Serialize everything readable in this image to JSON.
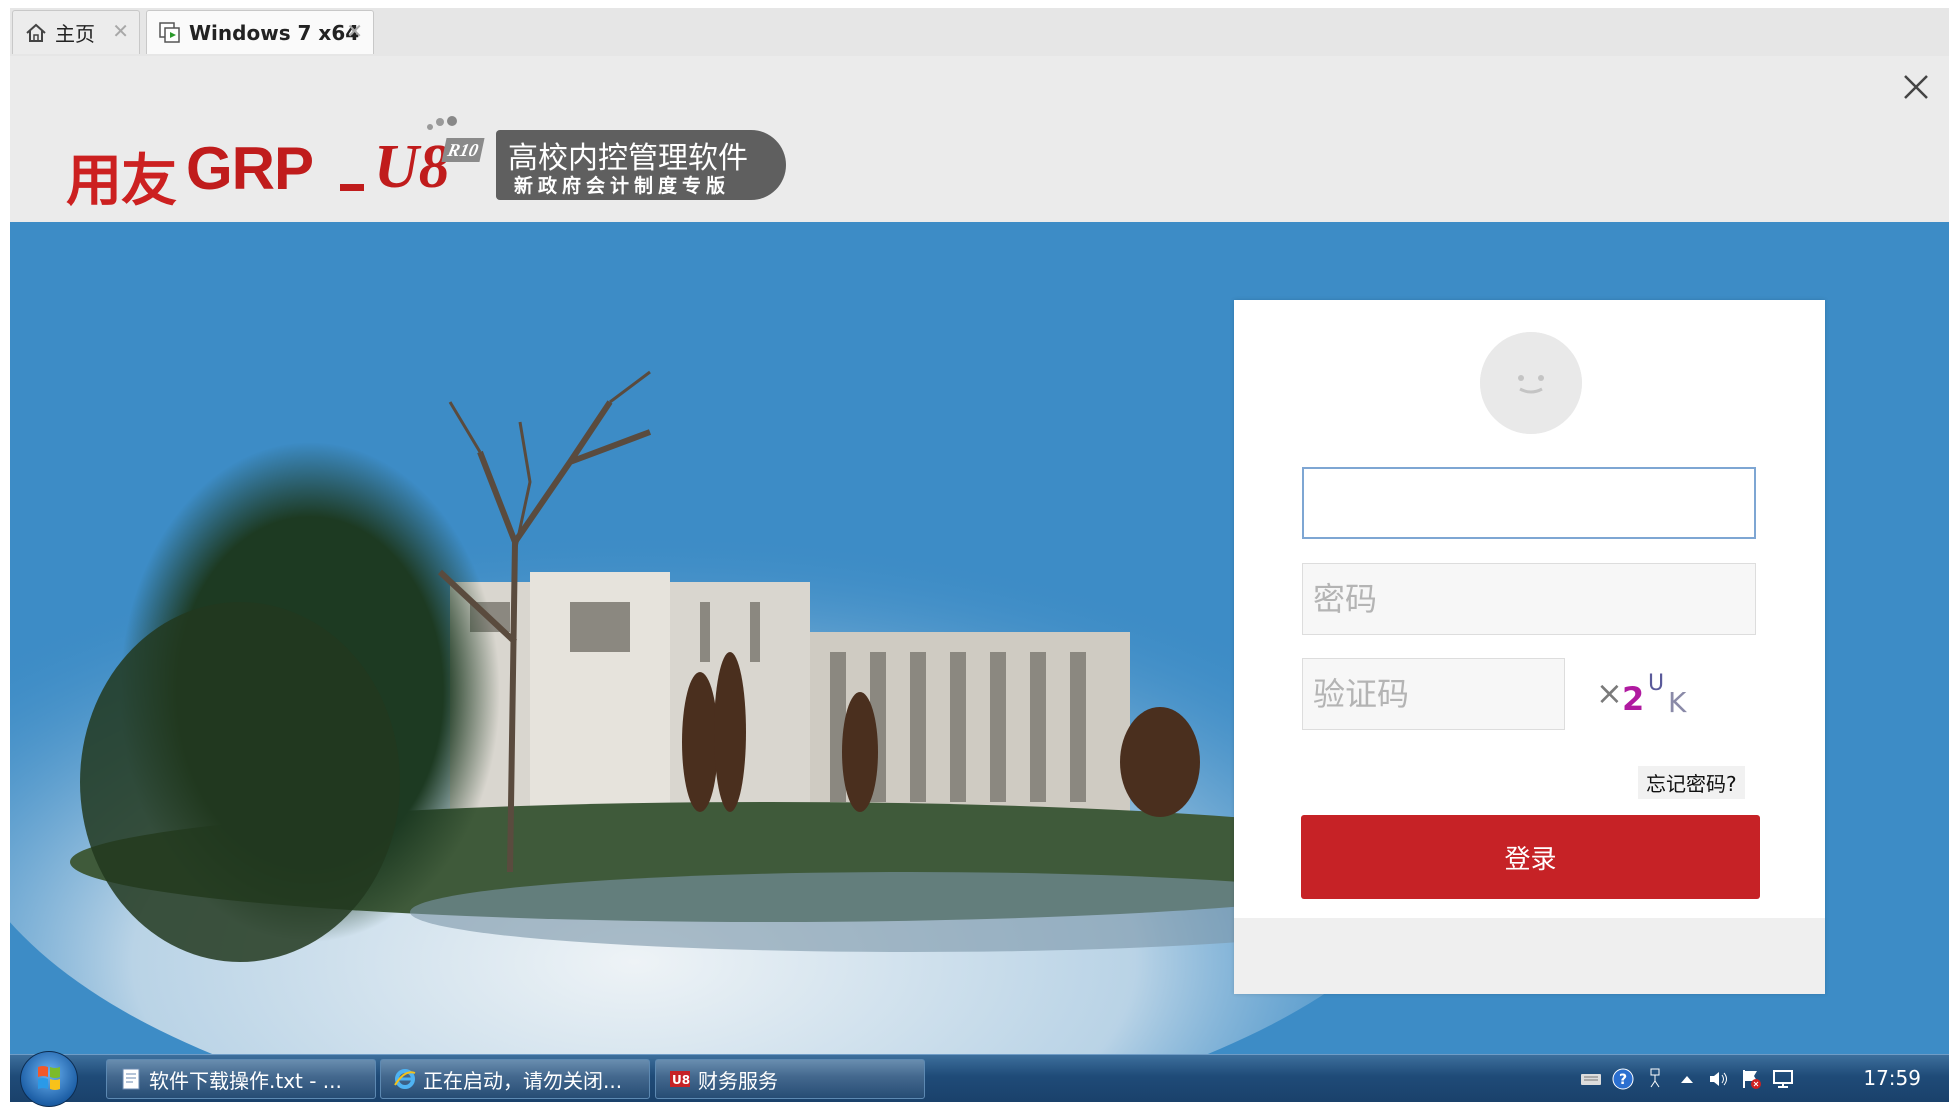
{
  "tabs": [
    {
      "label": "主页",
      "icon": "home-icon"
    },
    {
      "label": "Windows 7 x64",
      "icon": "vm-icon"
    }
  ],
  "header": {
    "logo_brand": "用友",
    "logo_product": "GRP",
    "logo_version": "R10",
    "logo_mark": "U8",
    "slogan_line1": "高校内控管理软件",
    "slogan_line2": "新政府会计制度专版"
  },
  "login": {
    "username_value": "",
    "password_placeholder": "密码",
    "captcha_placeholder": "验证码",
    "captcha_text": "X2UK",
    "forgot_label": "忘记密码?",
    "login_label": "登录"
  },
  "taskbar": {
    "items": [
      {
        "label": "软件下载操作.txt - ...",
        "icon": "notepad-icon"
      },
      {
        "label": "正在启动，请勿关闭...",
        "icon": "ie-icon"
      },
      {
        "label": "财务服务",
        "icon": "u8-icon"
      }
    ],
    "clock": "17:59"
  },
  "colors": {
    "brand_red": "#c62226",
    "background_blue": "#3d8cc6"
  }
}
